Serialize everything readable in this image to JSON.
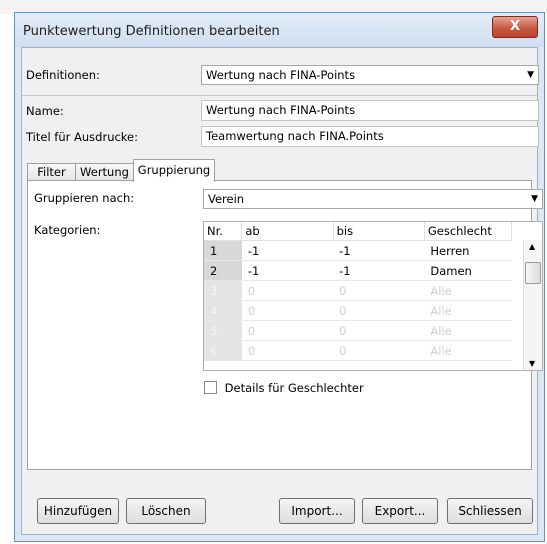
{
  "window": {
    "title": "Punktewertung Definitionen bearbeiten",
    "close_label": "X"
  },
  "definitions": {
    "label": "Definitionen:",
    "value": "Wertung nach FINA-Points"
  },
  "name": {
    "label": "Name:",
    "value": "Wertung nach FINA-Points"
  },
  "print_title": {
    "label": "Titel für Ausdrucke:",
    "value": "Teamwertung nach FINA.Points"
  },
  "tabs": [
    {
      "label": "Filter"
    },
    {
      "label": "Wertung"
    },
    {
      "label": "Gruppierung"
    }
  ],
  "gruppierung": {
    "group_by_label": "Gruppieren nach:",
    "group_by_value": "Verein",
    "categories_label": "Kategorien:",
    "columns": [
      "Nr.",
      "ab",
      "bis",
      "Geschlecht"
    ],
    "rows": [
      {
        "nr": "1",
        "ab": "-1",
        "bis": "-1",
        "geschlecht": "Herren"
      },
      {
        "nr": "2",
        "ab": "-1",
        "bis": "-1",
        "geschlecht": "Damen"
      },
      {
        "nr": "3",
        "ab": "0",
        "bis": "0",
        "geschlecht": "Alle"
      },
      {
        "nr": "4",
        "ab": "0",
        "bis": "0",
        "geschlecht": "Alle"
      },
      {
        "nr": "5",
        "ab": "0",
        "bis": "0",
        "geschlecht": "Alle"
      },
      {
        "nr": "6",
        "ab": "0",
        "bis": "0",
        "geschlecht": "Alle"
      }
    ],
    "details_checkbox_label": "Details für Geschlechter",
    "details_checked": false
  },
  "buttons": {
    "add": "Hinzufügen",
    "delete": "Löschen",
    "import": "Import...",
    "export": "Export...",
    "close": "Schliessen"
  },
  "icons": {
    "dropdown": "chevron-down-icon",
    "close": "close-icon"
  }
}
